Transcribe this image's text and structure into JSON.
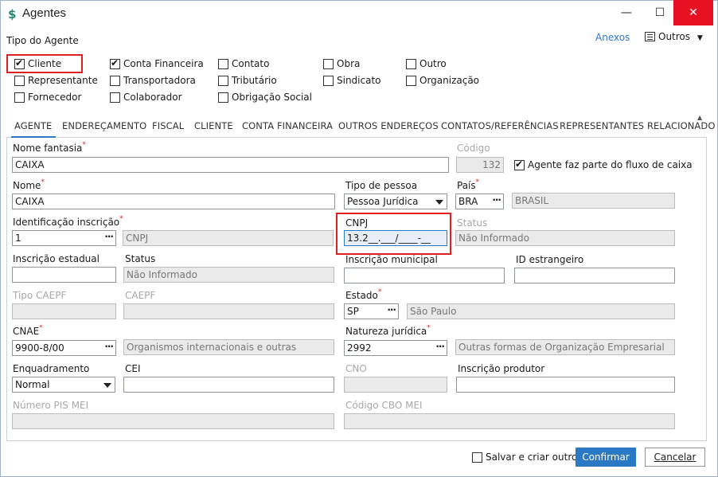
{
  "window": {
    "title": "Agentes",
    "icon": "app-s-icon",
    "minimize": "—",
    "maximize": "☐",
    "close": "✕"
  },
  "header": {
    "group_label": "Tipo do Agente",
    "anexos": "Anexos",
    "outros": "Outros"
  },
  "agent_types": [
    {
      "label": "Cliente",
      "checked": true
    },
    {
      "label": "Representante",
      "checked": false
    },
    {
      "label": "Fornecedor",
      "checked": false
    },
    {
      "label": "Conta Financeira",
      "checked": true
    },
    {
      "label": "Transportadora",
      "checked": false
    },
    {
      "label": "Colaborador",
      "checked": false
    },
    {
      "label": "Contato",
      "checked": false
    },
    {
      "label": "Tributário",
      "checked": false
    },
    {
      "label": "Obrigação Social",
      "checked": false
    },
    {
      "label": "Obra",
      "checked": false
    },
    {
      "label": "Sindicato",
      "checked": false
    },
    {
      "label": "Outro",
      "checked": false
    },
    {
      "label": "Organização",
      "checked": false
    }
  ],
  "tabs": [
    "AGENTE",
    "ENDEREÇAMENTO",
    "FISCAL",
    "CLIENTE",
    "CONTA FINANCEIRA",
    "OUTROS ENDEREÇOS",
    "CONTATOS/REFERÊNCIAS",
    "REPRESENTANTES RELACIONADO"
  ],
  "form": {
    "nome_fantasia": {
      "label": "Nome fantasia",
      "value": "CAIXA"
    },
    "codigo": {
      "label": "Código",
      "value": "132"
    },
    "fluxo": {
      "label": "Agente faz parte do fluxo de caixa",
      "checked": true
    },
    "nome": {
      "label": "Nome",
      "value": "CAIXA"
    },
    "tipo_pessoa": {
      "label": "Tipo de pessoa",
      "value": "Pessoa Jurídica"
    },
    "pais": {
      "label": "País",
      "code": "BRA",
      "name": "BRASIL"
    },
    "ident": {
      "label": "Identificação inscrição",
      "value": "1",
      "desc": "CNPJ"
    },
    "cnpj": {
      "label": "CNPJ",
      "value": "13.2__.___/____-__"
    },
    "status_top": {
      "label": "Status",
      "value": "Não Informado"
    },
    "insc_estadual": {
      "label": "Inscrição estadual",
      "value": ""
    },
    "status_ie": {
      "label": "Status",
      "value": "Não Informado"
    },
    "insc_municipal": {
      "label": "Inscrição municipal",
      "value": ""
    },
    "id_estrangeiro": {
      "label": "ID estrangeiro",
      "value": ""
    },
    "tipo_caepf": {
      "label": "Tipo CAEPF",
      "value": ""
    },
    "caepf": {
      "label": "CAEPF",
      "value": ""
    },
    "estado": {
      "label": "Estado",
      "code": "SP",
      "name": "São Paulo"
    },
    "cnae": {
      "label": "CNAE",
      "code": "9900-8/00",
      "desc": "Organismos internacionais e outras"
    },
    "natureza": {
      "label": "Natureza jurídica",
      "code": "2992",
      "desc": "Outras formas de Organização Empresarial"
    },
    "enquadramento": {
      "label": "Enquadramento",
      "value": "Normal"
    },
    "cei": {
      "label": "CEI",
      "value": ""
    },
    "cno": {
      "label": "CNO",
      "value": ""
    },
    "insc_produtor": {
      "label": "Inscrição produtor",
      "value": ""
    },
    "pis_mei": {
      "label": "Número PIS MEI",
      "value": ""
    },
    "cbo_mei": {
      "label": "Código CBO MEI",
      "value": ""
    }
  },
  "footer": {
    "salvar_criar": "Salvar e criar outro",
    "confirmar": "Confirmar",
    "cancelar": "Cancelar"
  },
  "colors": {
    "accent": "#2b78c5",
    "highlight": "#e02020",
    "close": "#e81123"
  }
}
